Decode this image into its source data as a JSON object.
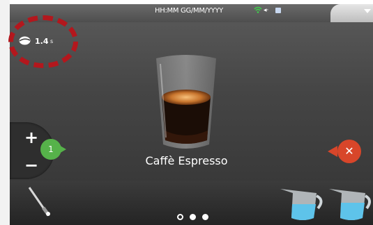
{
  "status": {
    "datetime": "HH:MM GG/MM/YYYY"
  },
  "strength": {
    "value": "1.4",
    "unit": "s"
  },
  "product": {
    "name": "Caffè Espresso"
  },
  "quantity": {
    "plus": "+",
    "minus": "−",
    "count": "1"
  },
  "cancel": {
    "symbol": "✕"
  },
  "colors": {
    "accent_green": "#56b24a",
    "cancel_red": "#d8462a",
    "highlight_ring": "#b3171d"
  },
  "icons": [
    "wifi-icon",
    "volume-icon",
    "card-icon",
    "bean-icon",
    "espresso-cup-icon",
    "steam-wand-icon",
    "milk-pitcher-icon"
  ]
}
